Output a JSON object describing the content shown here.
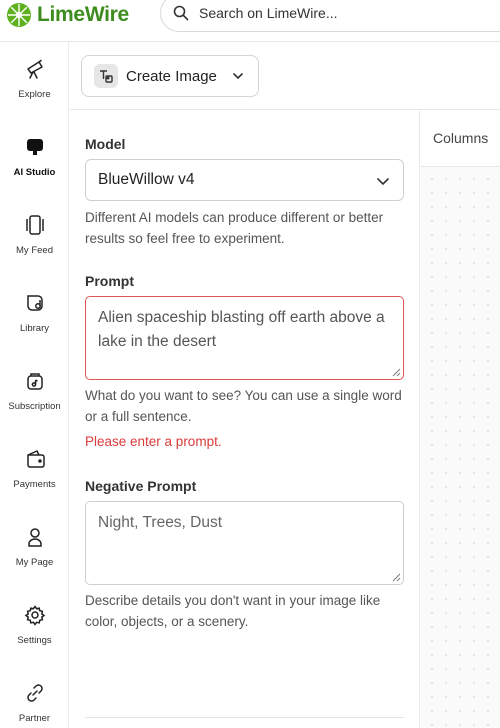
{
  "brand": {
    "name": "LimeWire",
    "color": "#3d8c1e"
  },
  "search": {
    "placeholder": "Search on LimeWire..."
  },
  "sidebar": {
    "items": [
      {
        "label": "Explore",
        "icon": "telescope-icon"
      },
      {
        "label": "AI Studio",
        "icon": "ai-studio-icon",
        "active": true
      },
      {
        "label": "My Feed",
        "icon": "feed-icon"
      },
      {
        "label": "Library",
        "icon": "library-icon"
      },
      {
        "label": "Subscription",
        "icon": "subscription-icon"
      },
      {
        "label": "Payments",
        "icon": "wallet-icon"
      },
      {
        "label": "My Page",
        "icon": "user-icon"
      },
      {
        "label": "Settings",
        "icon": "gear-icon"
      },
      {
        "label": "Partner",
        "icon": "link-icon"
      }
    ]
  },
  "toolbar": {
    "mode_label": "Create Image"
  },
  "form": {
    "model_label": "Model",
    "model_value": "BlueWillow v4",
    "model_help": "Different AI models can produce different or better results so feel free to experiment.",
    "prompt_label": "Prompt",
    "prompt_value": "Alien spaceship blasting off earth above a lake in the desert",
    "prompt_help": "What do you want to see? You can use a single word or a full sentence.",
    "prompt_error": "Please enter a prompt.",
    "negative_label": "Negative Prompt",
    "negative_value": "Night, Trees, Dust",
    "negative_help": "Describe details you don't want in your image like color, objects, or a scenery."
  },
  "right_panel": {
    "columns_label": "Columns"
  },
  "colors": {
    "error": "#d93a3a",
    "accent": "#3d8c1e"
  }
}
